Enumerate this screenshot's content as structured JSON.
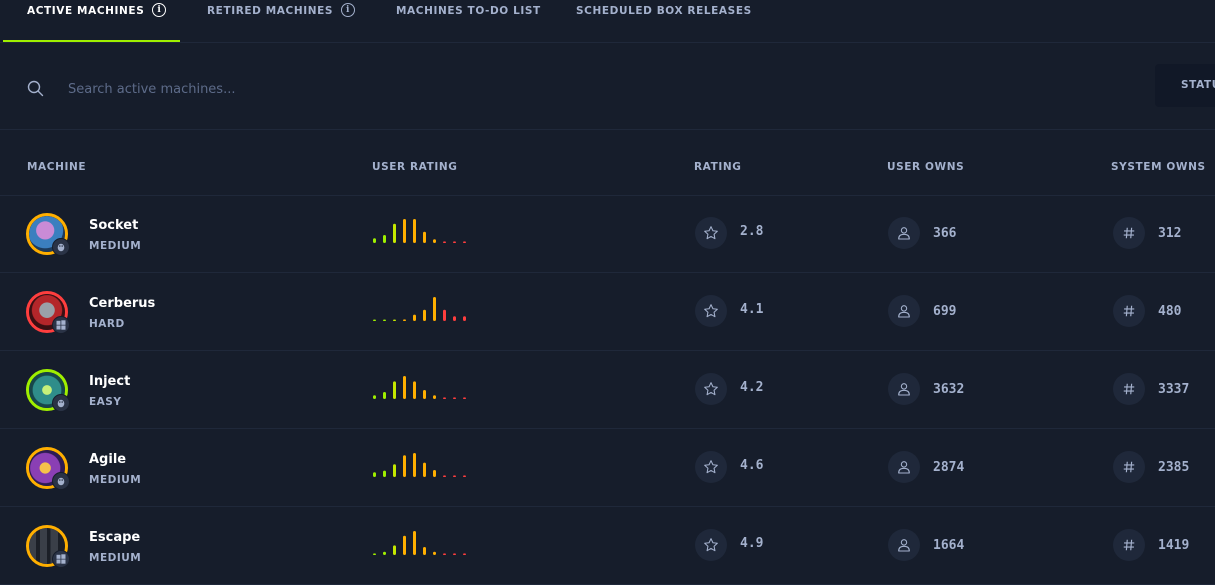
{
  "tabs": [
    {
      "label": "ACTIVE MACHINES",
      "active": true,
      "info": true
    },
    {
      "label": "RETIRED MACHINES",
      "active": false,
      "info": true
    },
    {
      "label": "MACHINES TO-DO LIST",
      "active": false,
      "info": false
    },
    {
      "label": "SCHEDULED BOX RELEASES",
      "active": false,
      "info": false
    }
  ],
  "search": {
    "placeholder": "Search active machines..."
  },
  "status_button": {
    "label": "STATUS"
  },
  "table": {
    "headers": {
      "machine": "MACHINE",
      "user_rating": "USER RATING",
      "rating": "RATING",
      "user_owns": "USER OWNS",
      "system_owns": "SYSTEM OWNS"
    },
    "rows": [
      {
        "name": "Socket",
        "difficulty": "MEDIUM",
        "os": "linux",
        "rating": "2.8",
        "user_owns": "366",
        "system_owns": "312",
        "rating_distribution": [
          0.15,
          0.25,
          0.6,
          0.75,
          0.75,
          0.35,
          0.12,
          0.05,
          0.05,
          0.05
        ]
      },
      {
        "name": "Cerberus",
        "difficulty": "HARD",
        "os": "windows",
        "rating": "4.1",
        "user_owns": "699",
        "system_owns": "480",
        "rating_distribution": [
          0.03,
          0.03,
          0.03,
          0.05,
          0.2,
          0.35,
          0.75,
          0.35,
          0.15,
          0.15
        ]
      },
      {
        "name": "Inject",
        "difficulty": "EASY",
        "os": "linux",
        "rating": "4.2",
        "user_owns": "3632",
        "system_owns": "3337",
        "rating_distribution": [
          0.12,
          0.22,
          0.55,
          0.72,
          0.55,
          0.28,
          0.12,
          0.05,
          0.05,
          0.05
        ]
      },
      {
        "name": "Agile",
        "difficulty": "MEDIUM",
        "os": "linux",
        "rating": "4.6",
        "user_owns": "2874",
        "system_owns": "2385",
        "rating_distribution": [
          0.15,
          0.2,
          0.4,
          0.68,
          0.75,
          0.45,
          0.22,
          0.05,
          0.05,
          0.05
        ]
      },
      {
        "name": "Escape",
        "difficulty": "MEDIUM",
        "os": "windows",
        "rating": "4.9",
        "user_owns": "1664",
        "system_owns": "1419",
        "rating_distribution": [
          0.05,
          0.1,
          0.3,
          0.6,
          0.75,
          0.25,
          0.1,
          0.05,
          0.05,
          0.05
        ]
      }
    ]
  },
  "icons": {
    "search": "search-icon",
    "info": "info-icon",
    "star": "star-icon",
    "user": "user-icon",
    "system": "hash-icon",
    "linux": "linux-icon",
    "windows": "windows-icon"
  },
  "colors": {
    "background": "#161d2b",
    "accent": "#9fef00",
    "text": "#a4b1cd",
    "title": "#ffffff",
    "rating_scale": [
      "#9fef00",
      "#9fef00",
      "#c5e800",
      "#ffaf00",
      "#ffaf00",
      "#ffaf00",
      "#ffaf00",
      "#ff3e3e",
      "#ff3e3e",
      "#ff3e3e"
    ],
    "avatar_rings": [
      "#ffaf00",
      "#ff3e3e",
      "#9fef00",
      "#ffaf00",
      "#ffaf00"
    ]
  }
}
